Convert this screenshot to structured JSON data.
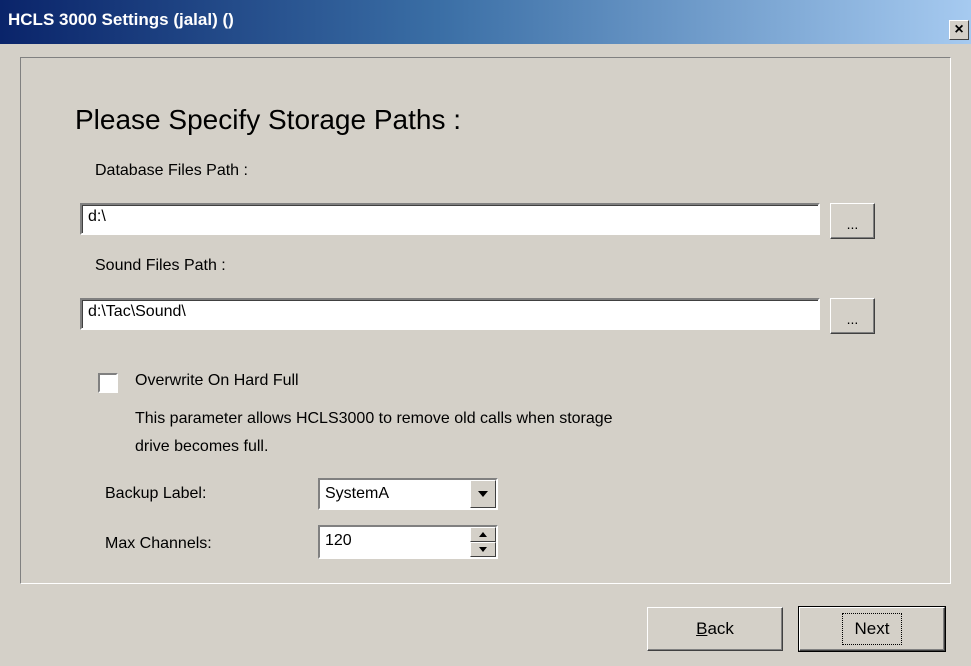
{
  "window": {
    "title": "HCLS 3000 Settings (jalal) ()",
    "close_label": "×"
  },
  "heading": "Please Specify Storage Paths :",
  "database": {
    "label": "Database Files Path :",
    "value": "d:\\",
    "browse_label": "..."
  },
  "sound": {
    "label": "Sound Files Path :",
    "value": "d:\\Tac\\Sound\\",
    "browse_label": "..."
  },
  "overwrite": {
    "label": "Overwrite On Hard Full",
    "checked": false,
    "description_line1": "This parameter allows HCLS3000 to remove old calls when storage",
    "description_line2": "drive becomes full."
  },
  "backup_label": {
    "label": "Backup Label:",
    "value": "SystemA"
  },
  "max_channels": {
    "label": "Max Channels:",
    "value": "120"
  },
  "buttons": {
    "back": "Back",
    "next": "Next"
  }
}
